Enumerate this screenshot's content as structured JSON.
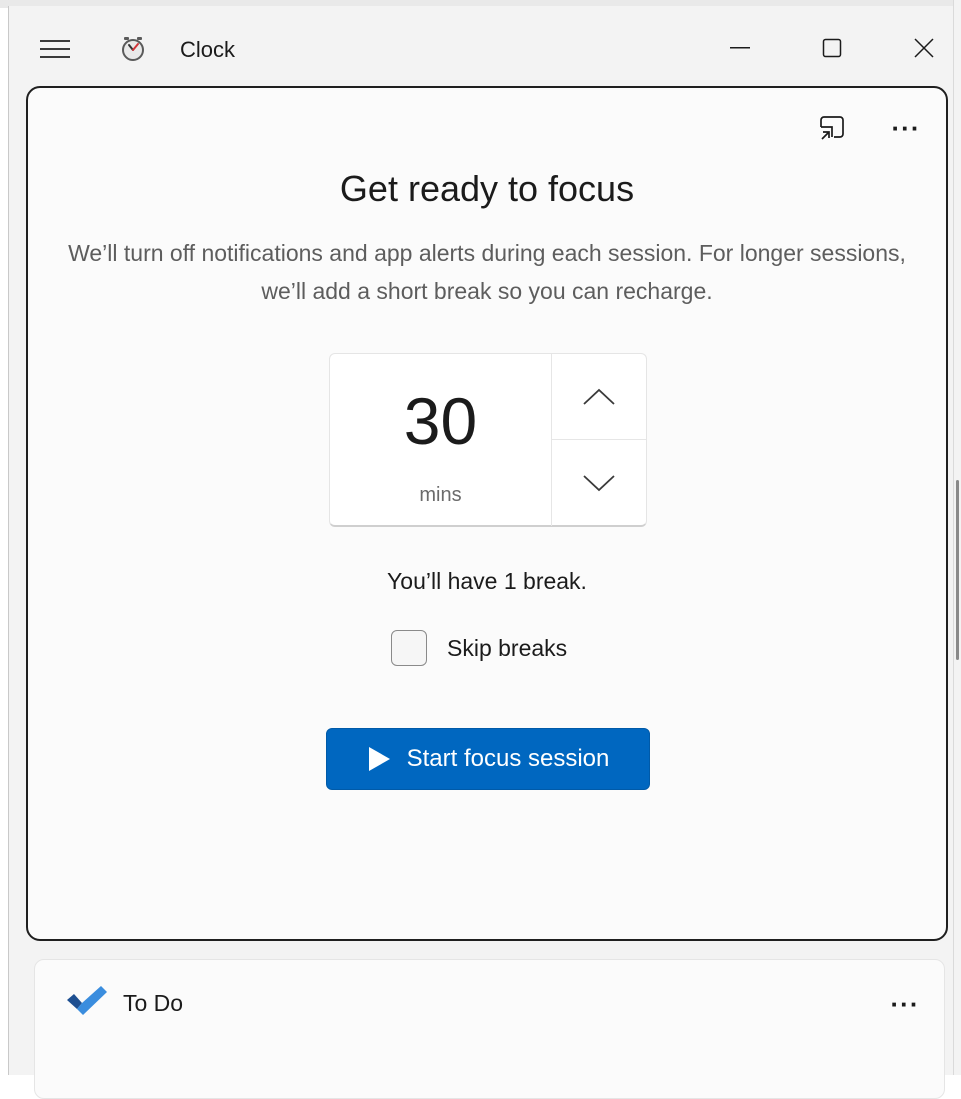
{
  "window": {
    "title": "Clock",
    "icons": {
      "menu": "hamburger-menu-icon",
      "app": "clock-app-icon",
      "minimize": "minimize-icon",
      "maximize": "maximize-icon",
      "close": "close-icon"
    }
  },
  "focus": {
    "title": "Get ready to focus",
    "description": "We’ll turn off notifications and app alerts during each session. For longer sessions, we’ll add a short break so you can recharge.",
    "duration_value": "30",
    "duration_unit": "mins",
    "break_info": "You’ll have 1 break.",
    "skip_breaks_label": "Skip breaks",
    "skip_breaks_checked": false,
    "start_label": "Start focus session",
    "accent_color": "#0067c0",
    "icons": {
      "compact": "compact-overlay-icon",
      "more": "more-options-icon",
      "increment": "chevron-up-icon",
      "decrement": "chevron-down-icon",
      "start": "play-icon"
    }
  },
  "todo": {
    "title": "To Do",
    "icons": {
      "app": "todo-check-icon",
      "more": "more-options-icon"
    }
  }
}
